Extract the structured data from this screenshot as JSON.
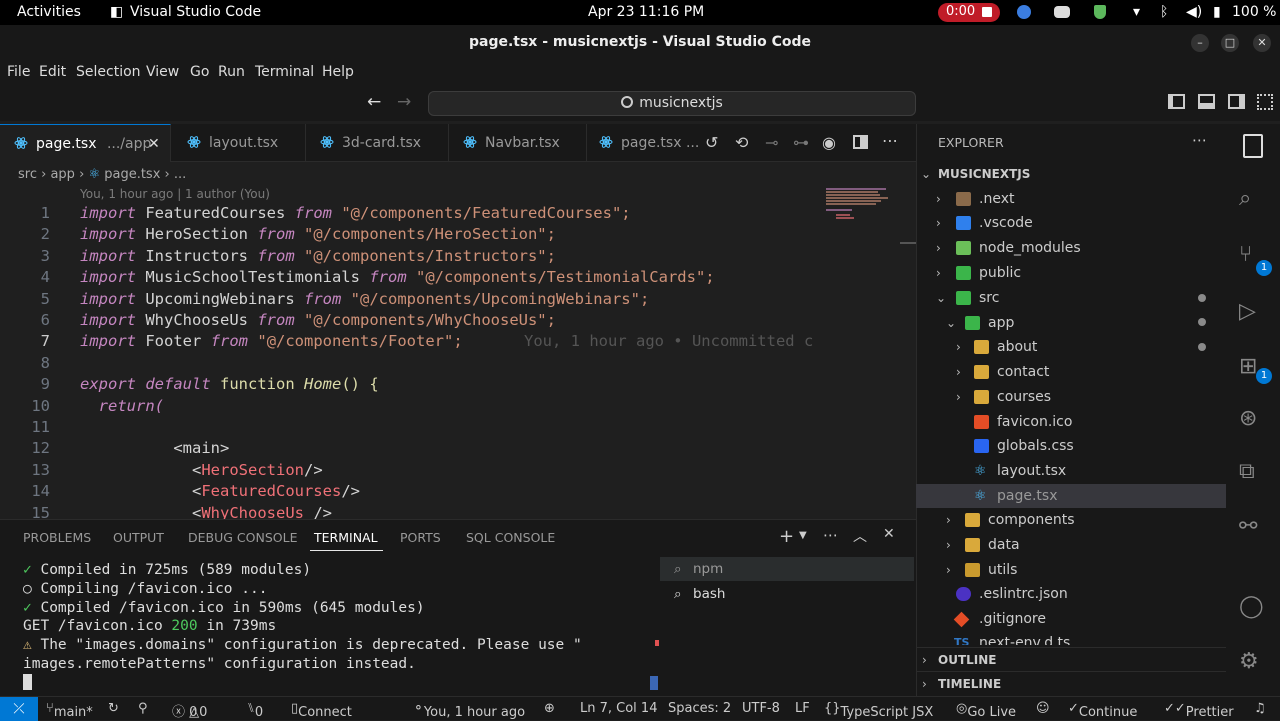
{
  "topbar": {
    "activities": "Activities",
    "app_name": "Visual Studio Code",
    "datetime": "Apr 23  11:16 PM",
    "rec_time": "0:00",
    "battery": "100 %"
  },
  "window": {
    "title": "page.tsx - musicnextjs - Visual Studio Code"
  },
  "menu": [
    "File",
    "Edit",
    "Selection",
    "View",
    "Go",
    "Run",
    "Terminal",
    "Help"
  ],
  "command_center": {
    "text": "musicnextjs"
  },
  "tabs": [
    {
      "label": "page.tsx",
      "detail": ".../app"
    },
    {
      "label": "layout.tsx"
    },
    {
      "label": "3d-card.tsx"
    },
    {
      "label": "Navbar.tsx"
    },
    {
      "label": "page.tsx",
      "detail": "..."
    }
  ],
  "breadcrumb": {
    "p1": "src",
    "p2": "app",
    "p3": "page.tsx",
    "p4": "..."
  },
  "blame": "You, 1 hour ago | 1 author (You)",
  "ghost_text": "You, 1 hour ago • Uncommitted c",
  "code": {
    "kw_import": "import",
    "kw_from": "from",
    "kw_export": "export",
    "kw_default": "default",
    "kw_function": "function",
    "kw_return": "return(",
    "l1_id": "FeaturedCourses",
    "l1_str": "\"@/components/FeaturedCourses\";",
    "l2_id": "HeroSection",
    "l2_str": "\"@/components/HeroSection\";",
    "l3_id": "Instructors",
    "l3_str": "\"@/components/Instructors\";",
    "l4_id": "MusicSchoolTestimonials",
    "l4_str": "\"@/components/TestimonialCards\";",
    "l5_id": "UpcomingWebinars",
    "l5_str": "\"@/components/UpcomingWebinars\";",
    "l6_id": "WhyChooseUs",
    "l6_str": "\"@/components/WhyChooseUs\";",
    "l7_id": "Footer",
    "l7_str": "\"@/components/Footer\";",
    "fn_name": "Home",
    "fn_rest": "() {",
    "main_tag": "<main>",
    "l13_tag": "HeroSection",
    "l14_tag": "FeaturedCourses",
    "l15_tag": "WhyChooseUs",
    "line_numbers": [
      "1",
      "2",
      "3",
      "4",
      "5",
      "6",
      "7",
      "8",
      "9",
      "10",
      "11",
      "12",
      "13",
      "14",
      "15"
    ]
  },
  "panel": {
    "tabs": [
      "PROBLEMS",
      "OUTPUT",
      "DEBUG CONSOLE",
      "TERMINAL",
      "PORTS",
      "SQL CONSOLE"
    ],
    "terminal": {
      "l1_mark": "✓",
      "l1_text": "Compiled in 725ms (589 modules)",
      "l2_mark": "○",
      "l2_text": "Compiling /favicon.ico ...",
      "l3_mark": "✓",
      "l3_text": "Compiled /favicon.ico in 590ms (645 modules)",
      "l4_a": "GET /favicon.ico ",
      "l4_code": "200",
      "l4_b": " in 739ms",
      "l5_mark": "⚠",
      "l5_text": "The \"images.domains\" configuration is deprecated. Please use \"",
      "l6_text": "images.remotePatterns\" configuration instead."
    },
    "terminals": [
      "npm",
      "bash"
    ]
  },
  "explorer": {
    "title": "EXPLORER",
    "root": "MUSICNEXTJS",
    "items": [
      {
        "label": ".next"
      },
      {
        "label": ".vscode"
      },
      {
        "label": "node_modules"
      },
      {
        "label": "public"
      },
      {
        "label": "src"
      },
      {
        "label": "app"
      },
      {
        "label": "about"
      },
      {
        "label": "contact"
      },
      {
        "label": "courses"
      },
      {
        "label": "favicon.ico"
      },
      {
        "label": "globals.css"
      },
      {
        "label": "layout.tsx"
      },
      {
        "label": "page.tsx"
      },
      {
        "label": "components"
      },
      {
        "label": "data"
      },
      {
        "label": "utils"
      },
      {
        "label": ".eslintrc.json"
      },
      {
        "label": ".gitignore"
      },
      {
        "label": "next-env.d.ts"
      }
    ],
    "outline": "OUTLINE",
    "timeline": "TIMELINE"
  },
  "activity_badges": {
    "source_control": "1",
    "extensions": "1"
  },
  "statusbar": {
    "branch": "main*",
    "errors": "0",
    "warnings": "0",
    "ports": "0",
    "connect": "Connect",
    "blame": "You, 1 hour ago",
    "position": "Ln 7, Col 14",
    "spaces": "Spaces: 2",
    "encoding": "UTF-8",
    "eol": "LF",
    "language": "TypeScript JSX",
    "golive": "Go Live",
    "continue": "Continue",
    "prettier": "Prettier"
  },
  "colors": {
    "accent": "#0078d4",
    "record": "#c01c28",
    "string": "#ce9178",
    "keyword": "#c586c0",
    "tag": "#f07178"
  }
}
